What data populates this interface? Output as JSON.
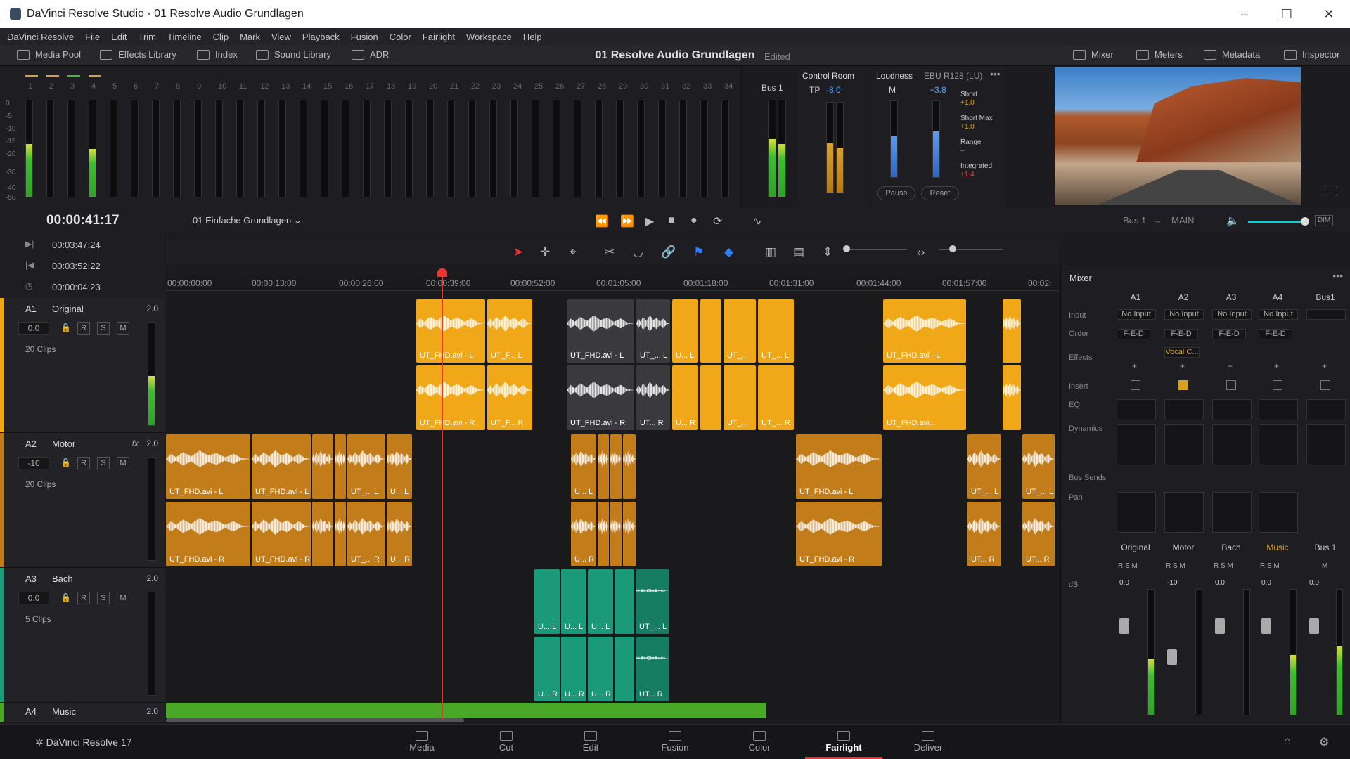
{
  "window": {
    "title": "DaVinci Resolve Studio - 01 Resolve Audio Grundlagen",
    "minimize": "–",
    "maximize": "☐",
    "close": "✕"
  },
  "menu": [
    "DaVinci Resolve",
    "File",
    "Edit",
    "Trim",
    "Timeline",
    "Clip",
    "Mark",
    "View",
    "Playback",
    "Fusion",
    "Color",
    "Fairlight",
    "Workspace",
    "Help"
  ],
  "toolbar": {
    "media_pool": "Media Pool",
    "effects_library": "Effects Library",
    "index": "Index",
    "sound_library": "Sound Library",
    "adr": "ADR",
    "mixer": "Mixer",
    "meters": "Meters",
    "metadata": "Metadata",
    "inspector": "Inspector"
  },
  "project": {
    "name": "01 Resolve Audio Grundlagen",
    "status": "Edited"
  },
  "meters": {
    "channels": [
      "1",
      "2",
      "3",
      "4",
      "5",
      "6",
      "7",
      "8",
      "9",
      "10",
      "11",
      "12",
      "13",
      "14",
      "15",
      "16",
      "17",
      "18",
      "19",
      "20",
      "21",
      "22",
      "23",
      "24",
      "25",
      "26",
      "27",
      "28",
      "29",
      "30",
      "31",
      "32",
      "33",
      "34"
    ],
    "scale": [
      "0",
      "-5",
      "-10",
      "-15",
      "-20",
      "-30",
      "-40",
      "-50"
    ],
    "bus_label": "Bus 1"
  },
  "control_room": {
    "title": "Control Room",
    "tp_label": "TP",
    "tp_value": "-8.0"
  },
  "loudness": {
    "title": "Loudness",
    "standard": "EBU R128 (LU)",
    "m_label": "M",
    "m_value": "+3.8",
    "short_label": "Short",
    "short_value": "+1.0",
    "short_max_label": "Short Max",
    "short_max_value": "+1.0",
    "range_label": "Range",
    "range_value": "–",
    "integrated_label": "Integrated",
    "integrated_value": "+1.4",
    "pause": "Pause",
    "reset": "Reset"
  },
  "transport": {
    "timecode": "00:00:41:17",
    "timeline_name": "01 Einfache Grundlagen",
    "bus": "Bus 1",
    "main": "MAIN",
    "dim": "DIM"
  },
  "timecodes": {
    "in": "00:03:47:24",
    "out": "00:03:52:22",
    "duration": "00:00:04:23"
  },
  "ruler": [
    "00:00:00:00",
    "00:00:13:00",
    "00:00:26:00",
    "00:00:39:00",
    "00:00:52:00",
    "00:01:05:00",
    "00:01:18:00",
    "00:01:31:00",
    "00:01:44:00",
    "00:01:57:00",
    "00:02:"
  ],
  "tracks": [
    {
      "id": "A1",
      "name": "Original",
      "value": "2.0",
      "vol": "0.0",
      "clips": "20 Clips",
      "color": "#f0a718"
    },
    {
      "id": "A2",
      "name": "Motor",
      "value": "2.0",
      "vol": "-10",
      "clips": "20 Clips",
      "color": "#c27c1a",
      "fx": "fx"
    },
    {
      "id": "A3",
      "name": "Bach",
      "value": "2.0",
      "vol": "0.0",
      "clips": "5 Clips",
      "color": "#1a9a78"
    },
    {
      "id": "A4",
      "name": "Music",
      "value": "2.0",
      "color": "#4aa828"
    }
  ],
  "track_buttons": {
    "r": "R",
    "s": "S",
    "m": "M"
  },
  "clips": {
    "a1_l": "UT_FHD.avi - L",
    "a1_r": "UT_FHD.avi - R",
    "a1_l2": "UT_F... L",
    "a1_r2": "UT_F... R",
    "a1_gl": "UT_FHD.avi - L",
    "a1_gr": "UT_FHD.avi - R",
    "a1_gl2": "UT_... L",
    "a1_gr2": "UT... R",
    "a1_s1": "U... L",
    "a1_s2": "UT_...",
    "a1_s3": "UT_... L",
    "a1_s4": "U... R",
    "a1_s5": "UT_... R",
    "a1_end_l": "UT_FHD.avi - L",
    "a1_end_r": "UT_FHD.avi...",
    "a2_l": "UT_FHD.avi - L",
    "a2_r": "UT_FHD.avi - R",
    "a2_l2": "UT_FHD.avi - L",
    "a2_r2": "UT_FHD.avi - R",
    "a2_l3": "UT_... L",
    "a2_r3": "UT_... R",
    "a2_l4": "U... L",
    "a2_r4": "U... R",
    "a2_m_l": "U... L",
    "a2_m_r": "U... R",
    "a2_e_l": "UT_FHD.avi - L",
    "a2_e_r": "UT_FHD.avi - R",
    "a2_f_l": "UT_... L",
    "a2_f_r": "UT... R",
    "a2_g_l": "UT_... L",
    "a2_g_r": "UT... R",
    "a3_l": "U... L",
    "a3_r": "U... R",
    "a3_l2": "UT_... L",
    "a3_r2": "UT... R"
  },
  "mixer": {
    "title": "Mixer",
    "columns": [
      "A1",
      "A2",
      "A3",
      "A4",
      "Bus1"
    ],
    "row_labels": {
      "input": "Input",
      "order": "Order",
      "effects": "Effects",
      "insert": "Insert",
      "eq": "EQ",
      "dynamics": "Dynamics",
      "bus_sends": "Bus Sends",
      "pan": "Pan",
      "db": "dB"
    },
    "input": [
      "No Input",
      "No Input",
      "No Input",
      "No Input",
      ""
    ],
    "order": [
      "F-E-D",
      "F-E-D",
      "F-E-D",
      "F-E-D"
    ],
    "effect_a2": "Vocal C...",
    "names": [
      "Original",
      "Motor",
      "Bach",
      "Music",
      "Bus 1"
    ],
    "fader_values": [
      "0.0",
      "-10",
      "0.0",
      "0.0",
      "0.0"
    ],
    "fader_scale": [
      "0",
      "-5",
      "-10",
      "-15",
      "-20",
      "-30",
      "-40",
      "-50"
    ]
  },
  "nav": [
    "Media",
    "Cut",
    "Edit",
    "Fusion",
    "Color",
    "Fairlight",
    "Deliver"
  ],
  "nav_active": "Fairlight",
  "brand": "DaVinci Resolve 17"
}
